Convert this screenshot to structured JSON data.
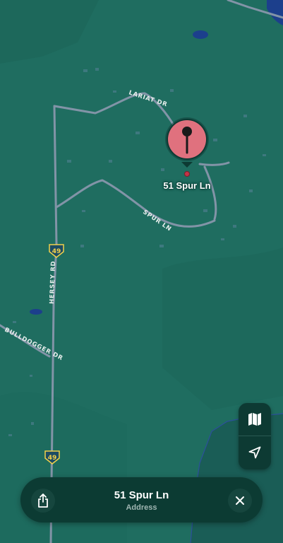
{
  "map": {
    "roads": {
      "lariat": "LARIAT DR",
      "spur": "SPUR LN",
      "hersey": "HERSEY RD",
      "bulldogger": "BULLDOGGER DR"
    },
    "route_shields": [
      "49",
      "49"
    ],
    "pin": {
      "label": "51 Spur Ln",
      "color": "#e0717e"
    }
  },
  "controls": {
    "map_mode_icon": "map-icon",
    "location_icon": "location-arrow-icon"
  },
  "place_card": {
    "title": "51 Spur Ln",
    "subtitle": "Address",
    "share_icon": "share-icon",
    "close_icon": "close-icon"
  },
  "colors": {
    "land": "#1f6d60",
    "road": "#8294a7",
    "water": "#1c3f8c",
    "card": "#0c3b33"
  }
}
